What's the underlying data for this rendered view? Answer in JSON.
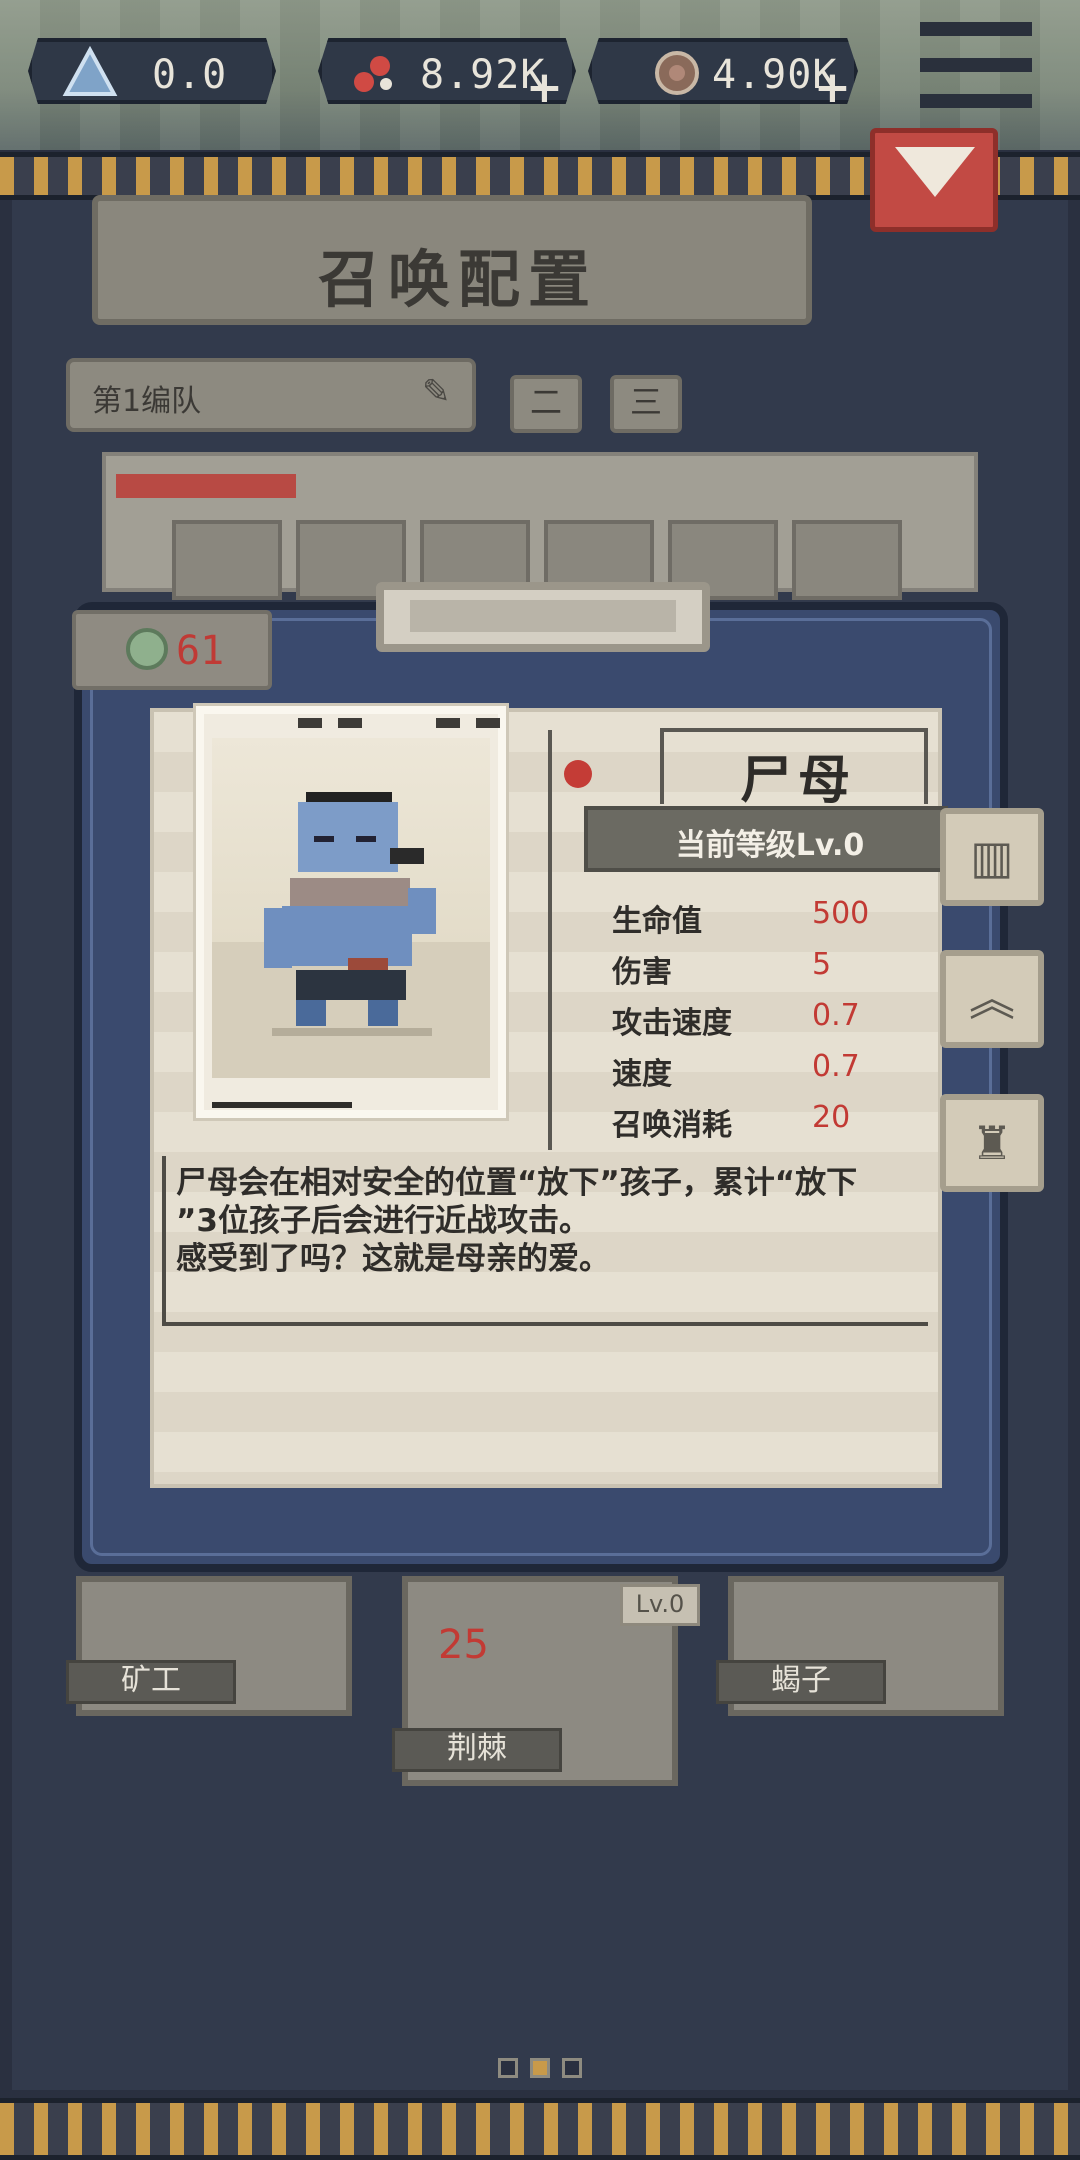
{
  "resources": [
    {
      "name": "triangle-crystal-icon",
      "value": "0.0"
    },
    {
      "name": "red-gem-icon",
      "value": "8.92K",
      "add_label": "+"
    },
    {
      "name": "coin-icon",
      "value": "4.90K",
      "add_label": "+"
    }
  ],
  "page": {
    "title": "召唤配置"
  },
  "squad": {
    "name": "第1编队",
    "tabs": [
      "二",
      "三"
    ]
  },
  "card_detail": {
    "cost": "61",
    "name": "尸母",
    "level_label": "当前等级Lv.0",
    "stats": [
      {
        "label": "生命值",
        "value": "500"
      },
      {
        "label": "伤害",
        "value": "5"
      },
      {
        "label": "攻击速度",
        "value": "0.7"
      },
      {
        "label": "速度",
        "value": "0.7"
      },
      {
        "label": "召唤消耗",
        "value": "20"
      }
    ],
    "description_lines": [
      "尸母会在相对安全的位置“放下”孩子，累计“放下",
      "”3位孩子后会进行近战攻击。",
      "感受到了吗？这就是母亲的爱。"
    ]
  },
  "side_buttons": [
    "book-icon",
    "upgrade-chevrons-icon",
    "shirt-icon"
  ],
  "bottom_cards": [
    {
      "label": "矿工"
    },
    {
      "label": "荆棘",
      "level": "Lv.0",
      "cost": "25"
    },
    {
      "label": "蝎子"
    }
  ],
  "colors": {
    "accent_red": "#c23a34",
    "panel_navy": "#3a4a6e",
    "paper": "#e6e0d2"
  },
  "pager": {
    "count": 3,
    "active_index": 1
  }
}
